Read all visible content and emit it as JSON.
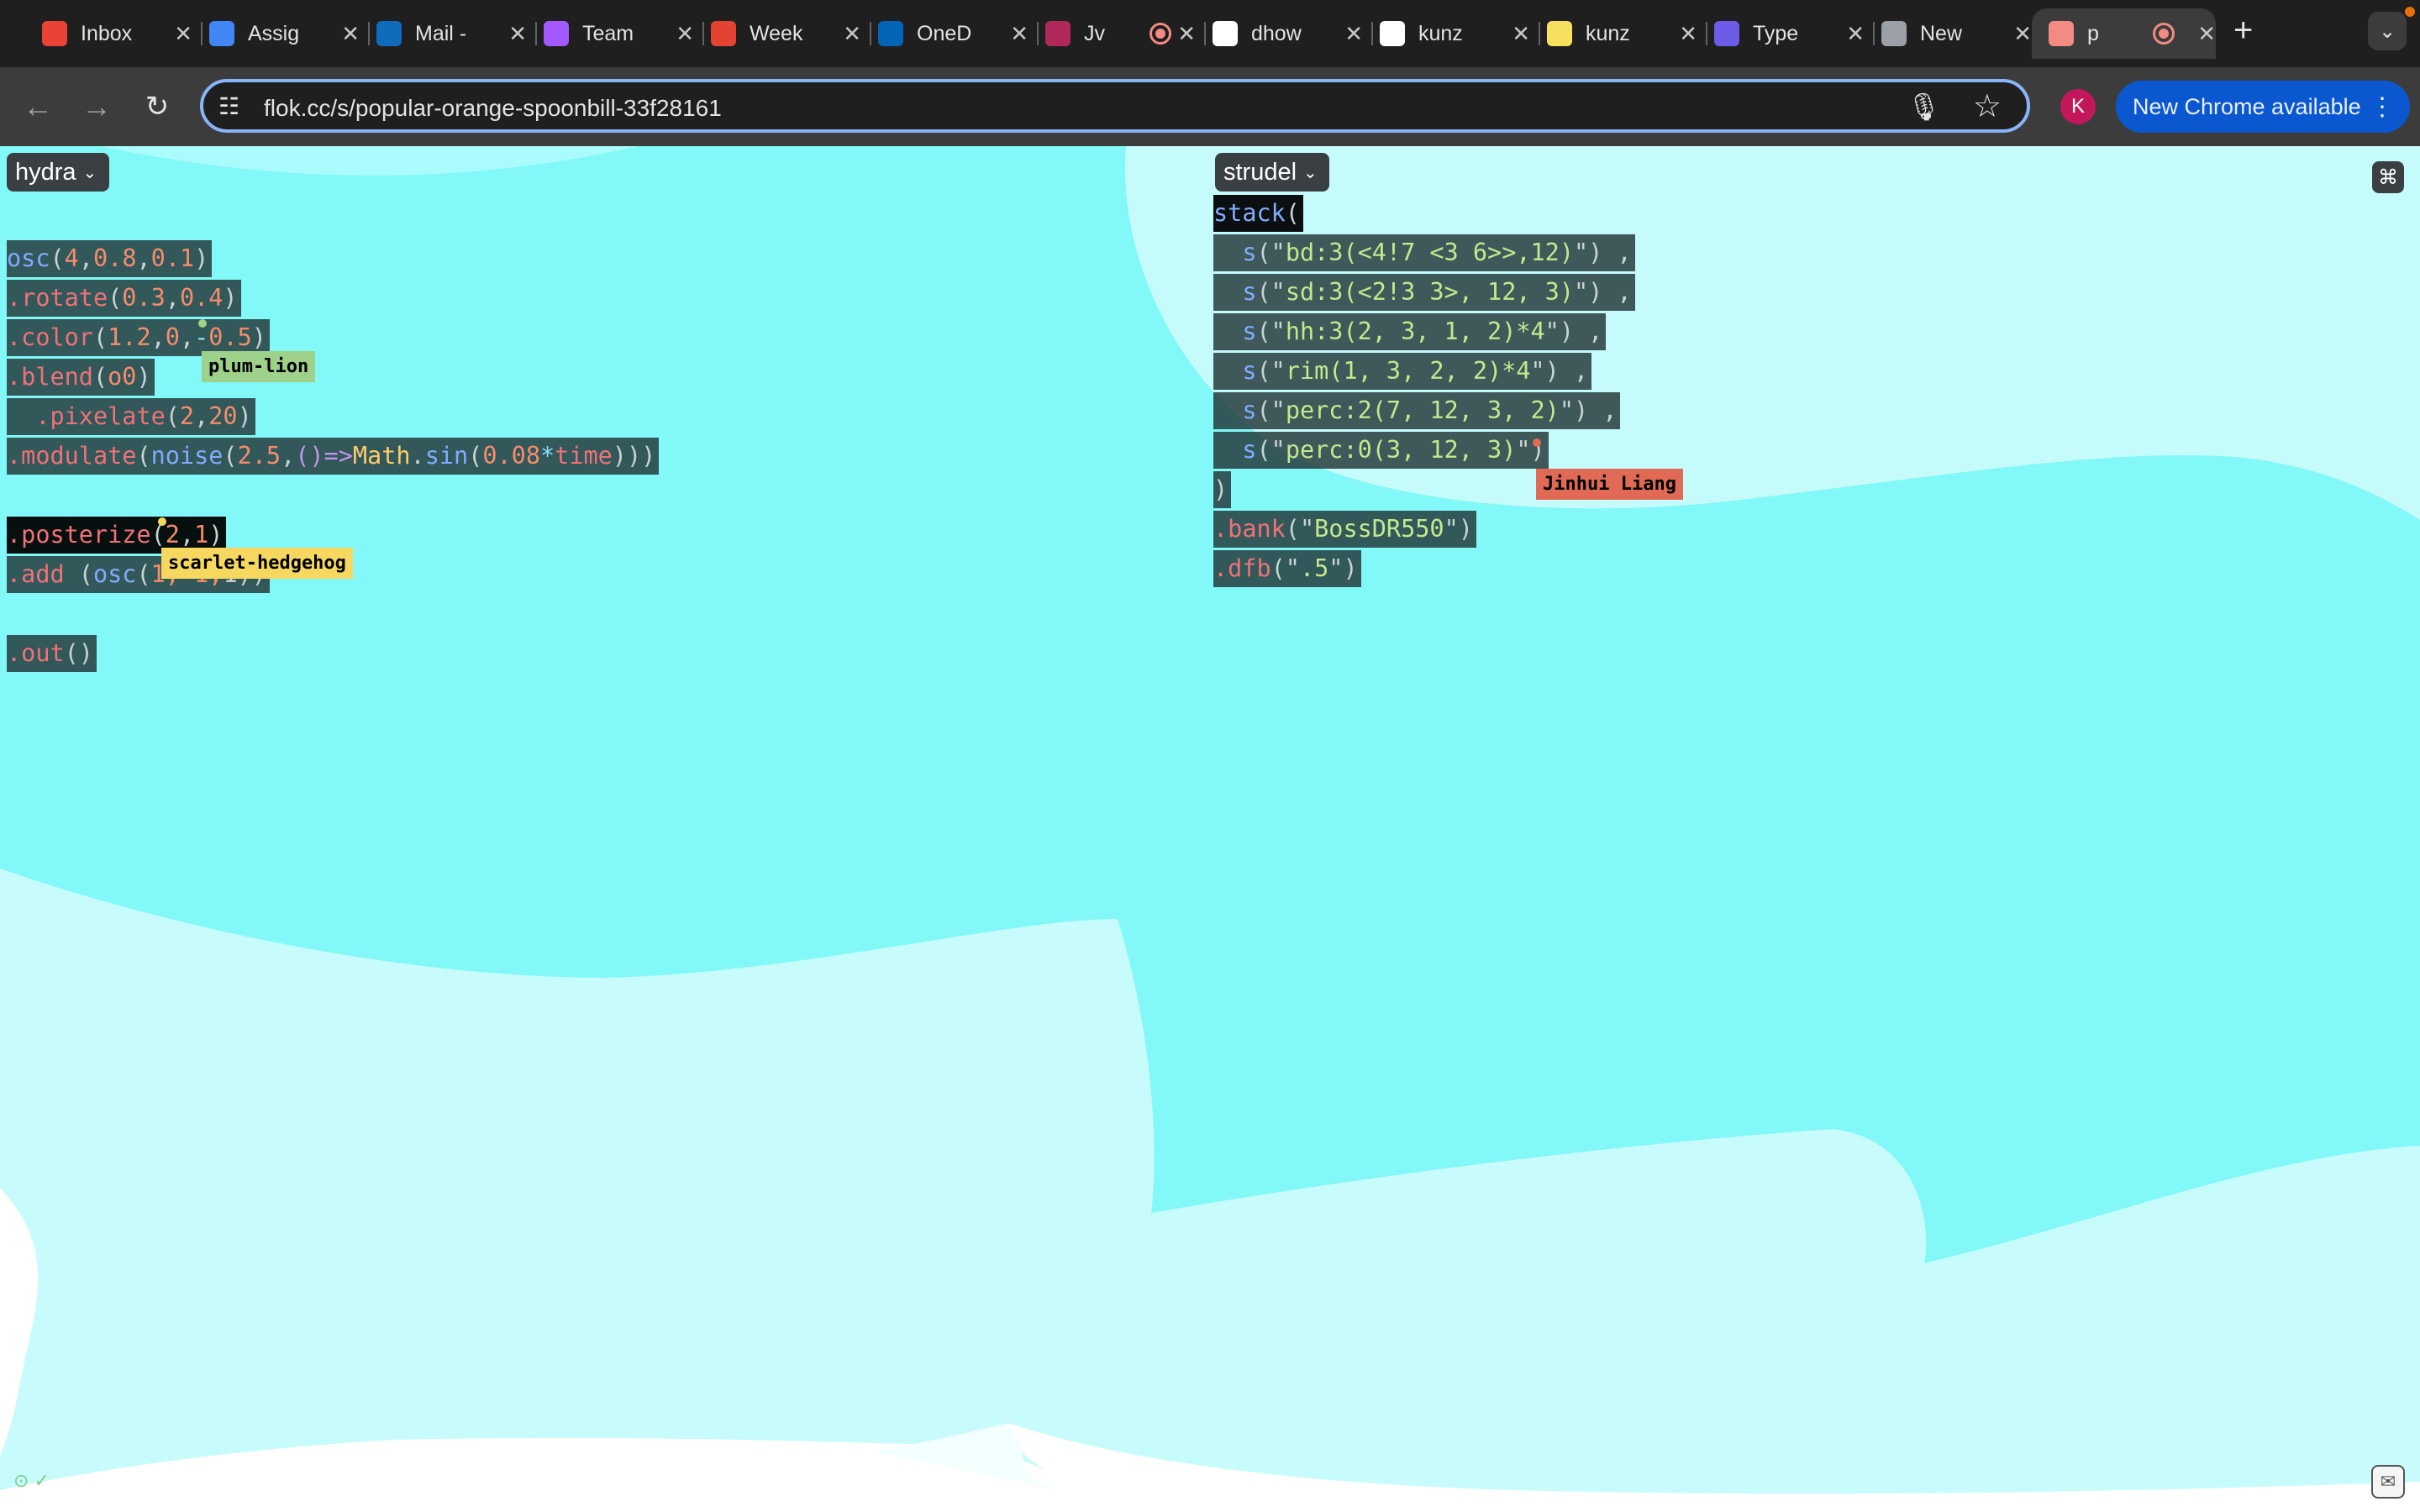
{
  "browser": {
    "tabs": [
      {
        "title": "Inbox",
        "icon": "gmail-icon",
        "color": "#ea4335"
      },
      {
        "title": "Assig",
        "icon": "docs-icon",
        "color": "#4285f4"
      },
      {
        "title": "Mail -",
        "icon": "outlook-icon",
        "color": "#0f6cbd"
      },
      {
        "title": "Team",
        "icon": "figma-icon",
        "color": "#a259ff"
      },
      {
        "title": "Week",
        "icon": "todoist-icon",
        "color": "#e44332"
      },
      {
        "title": "OneD",
        "icon": "onedrive-icon",
        "color": "#0364b8"
      },
      {
        "title": "Jv",
        "icon": "app-icon",
        "color": "#b0285a"
      },
      {
        "title": "dhow",
        "icon": "github-icon",
        "color": "#ffffff"
      },
      {
        "title": "kunz",
        "icon": "app-icon",
        "color": "#ffffff"
      },
      {
        "title": "kunz",
        "icon": "lemon-icon",
        "color": "#f6e05e"
      },
      {
        "title": "Type",
        "icon": "typeform-icon",
        "color": "#6c5ce7"
      },
      {
        "title": "New",
        "icon": "chrome-icon",
        "color": "#9aa0a6"
      },
      {
        "title": "p",
        "icon": "flok-icon",
        "color": "#f28b82"
      }
    ],
    "url": "flok.cc/s/popular-orange-spoonbill-33f28161",
    "profile_initial": "K",
    "update_label": "New Chrome available"
  },
  "editor": {
    "left_target": "hydra",
    "right_target": "strudel",
    "hydra_lines": [
      [
        [
          "osc",
          "k1"
        ],
        [
          "(",
          "k0"
        ],
        [
          "4",
          "k3"
        ],
        [
          ",",
          "k0"
        ],
        [
          "0.8",
          "k3"
        ],
        [
          ",",
          "k0"
        ],
        [
          "0.1",
          "k3"
        ],
        [
          ")",
          "k0"
        ]
      ],
      [
        [
          ".rotate",
          "k2"
        ],
        [
          "(",
          "k0"
        ],
        [
          "0.3",
          "k3"
        ],
        [
          ",",
          "k0"
        ],
        [
          "0.4",
          "k3"
        ],
        [
          ")",
          "k0"
        ]
      ],
      [
        [
          ".color",
          "k2"
        ],
        [
          "(",
          "k0"
        ],
        [
          "1.2",
          "k3"
        ],
        [
          ",",
          "k0"
        ],
        [
          "0",
          "k3"
        ],
        [
          ",",
          "k0"
        ],
        [
          "-",
          "k5"
        ],
        [
          "0.5",
          "k3"
        ],
        [
          ")",
          "k0"
        ]
      ],
      [
        [
          ".blend",
          "k2"
        ],
        [
          "(",
          "k0"
        ],
        [
          "o0",
          "k3"
        ],
        [
          ")",
          "k0"
        ]
      ],
      [
        [
          "  .pixelate",
          "k2"
        ],
        [
          "(",
          "k0"
        ],
        [
          "2",
          "k3"
        ],
        [
          ",",
          "k0"
        ],
        [
          "20",
          "k3"
        ],
        [
          ")",
          "k0"
        ]
      ],
      [
        [
          ".modulate",
          "k2"
        ],
        [
          "(",
          "k0"
        ],
        [
          "noise",
          "k1"
        ],
        [
          "(",
          "k0"
        ],
        [
          "2.5",
          "k3"
        ],
        [
          ",",
          "k0"
        ],
        [
          "()=>",
          "k6"
        ],
        [
          "Math",
          "k7"
        ],
        [
          ".",
          "k0"
        ],
        [
          "sin",
          "k1"
        ],
        [
          "(",
          "k0"
        ],
        [
          "0.08",
          "k3"
        ],
        [
          "*",
          "k5"
        ],
        [
          "time",
          "k2"
        ],
        [
          ")))",
          "k0"
        ]
      ],
      [],
      [
        [
          ".posterize",
          "k2"
        ],
        [
          "(",
          "k0"
        ],
        [
          "2",
          "k3"
        ],
        [
          ",",
          "k0"
        ],
        [
          "1",
          "k3"
        ],
        [
          ")",
          "k0"
        ]
      ],
      [
        [
          ".add ",
          "k2"
        ],
        [
          "(",
          "k0"
        ],
        [
          "osc",
          "k1"
        ],
        [
          "(",
          "k0"
        ],
        [
          "1, ",
          "k3"
        ],
        [
          "1,",
          "k3"
        ],
        [
          "1))",
          "k0"
        ]
      ],
      [],
      [
        [
          ".out",
          "k2"
        ],
        [
          "()",
          "k0"
        ]
      ]
    ],
    "strudel_lines": [
      [
        [
          "stack",
          "k1"
        ],
        [
          "(",
          "k0"
        ]
      ],
      [
        [
          "  s",
          "k1"
        ],
        [
          "(\"",
          "k0"
        ],
        [
          "bd:3(<4!7 <3 6>>,12)",
          "k4"
        ],
        [
          "\")",
          "k0"
        ],
        [
          " ,",
          "k0"
        ]
      ],
      [
        [
          "  s",
          "k1"
        ],
        [
          "(\"",
          "k0"
        ],
        [
          "sd:3(<2!3 3>, 12, 3)",
          "k4"
        ],
        [
          "\")",
          "k0"
        ],
        [
          " ,",
          "k0"
        ]
      ],
      [
        [
          "  s",
          "k1"
        ],
        [
          "(\"",
          "k0"
        ],
        [
          "hh:3(2, 3, 1, 2)*4",
          "k4"
        ],
        [
          "\")",
          "k0"
        ],
        [
          " ,",
          "k0"
        ]
      ],
      [
        [
          "  s",
          "k1"
        ],
        [
          "(\"",
          "k0"
        ],
        [
          "rim(1, 3, 2, 2)*4",
          "k4"
        ],
        [
          "\")",
          "k0"
        ],
        [
          " ,",
          "k0"
        ]
      ],
      [
        [
          "  s",
          "k1"
        ],
        [
          "(\"",
          "k0"
        ],
        [
          "perc:2(7, 12, 3, 2)",
          "k4"
        ],
        [
          "\")",
          "k0"
        ],
        [
          " ,",
          "k0"
        ]
      ],
      [
        [
          "  s",
          "k1"
        ],
        [
          "(\"",
          "k0"
        ],
        [
          "perc:0(3, 12, 3)",
          "k4"
        ],
        [
          "\")",
          "k0"
        ]
      ],
      [
        [
          ")",
          "k0"
        ]
      ],
      [
        [
          ".bank",
          "k2"
        ],
        [
          "(\"",
          "k0"
        ],
        [
          "BossDR550",
          "k4"
        ],
        [
          "\")",
          "k0"
        ]
      ],
      [
        [
          ".dfb",
          "k2"
        ],
        [
          "(\"",
          "k0"
        ],
        [
          ".5",
          "k4"
        ],
        [
          "\")",
          "k0"
        ]
      ]
    ],
    "cursors": [
      {
        "name": "plum-lion",
        "color": "#9ed18a"
      },
      {
        "name": "scarlet-hedgehog",
        "color": "#f6d860"
      },
      {
        "name": "Jinhui Liang",
        "color": "#e06a56"
      }
    ],
    "shortcut_icon": "command-icon",
    "messages_icon": "messages-icon"
  }
}
